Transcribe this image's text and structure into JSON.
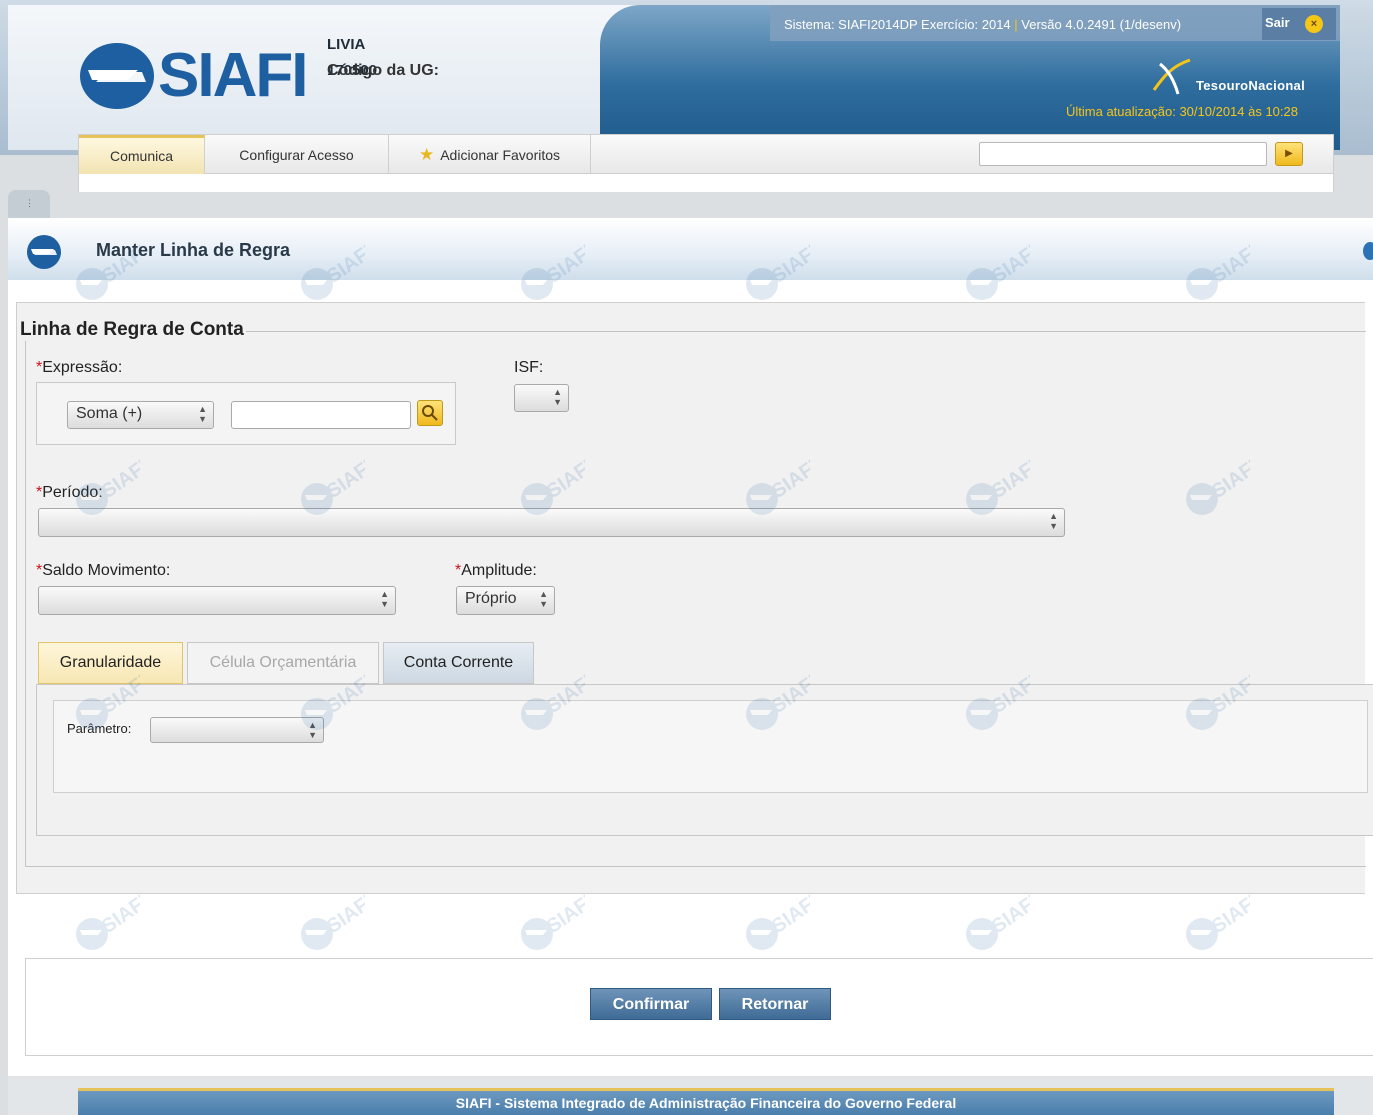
{
  "header": {
    "system_info_1": "Sistema: SIAFI2014DP Exercício: 2014",
    "system_info_sep": "|",
    "system_info_2": "Versão 4.0.2491 (1/desenv)",
    "logout_label": "Sair",
    "logout_icon": "close-icon",
    "logo_text": "SIAFI",
    "user_name": "LIVIA",
    "ug_label": "Código da UG:",
    "ug_value": "170500",
    "org_name": "TesouroNacional",
    "last_update": "Última atualização: 30/10/2014 às 10:28"
  },
  "menu": {
    "items": [
      {
        "label": "Comunica"
      },
      {
        "label": "Configurar Acesso"
      },
      {
        "label": "Adicionar Favoritos",
        "icon": "star-icon"
      }
    ],
    "search_value": "",
    "go_icon": "arrow-right-icon"
  },
  "page": {
    "title": "Manter Linha de Regra",
    "section_title": "Linha de Regra de Conta"
  },
  "form": {
    "required_mark": "*",
    "expressao_label": "Expressão:",
    "operator_value": "Soma (+)",
    "expression_value": "",
    "isf_label": "ISF:",
    "isf_value": "",
    "periodo_label": "Período:",
    "periodo_value": "",
    "saldo_label": "Saldo Movimento:",
    "saldo_value": "",
    "amplitude_label": "Amplitude:",
    "amplitude_value": "Próprio"
  },
  "tabs": [
    {
      "label": "Granularidade",
      "state": "active"
    },
    {
      "label": "Célula Orçamentária",
      "state": "disabled"
    },
    {
      "label": "Conta Corrente",
      "state": "normal"
    }
  ],
  "granularidade": {
    "parametro_label": "Parâmetro:",
    "parametro_value": ""
  },
  "actions": {
    "confirm_label": "Confirmar",
    "return_label": "Retornar"
  },
  "footer": {
    "text": "SIAFI - Sistema Integrado de Administração Financeira do Governo Federal"
  },
  "colors": {
    "brand_blue": "#1d5fa0",
    "accent_yellow": "#f5c518",
    "required_red": "#d0101a",
    "button_blue": "#3f6b96"
  }
}
